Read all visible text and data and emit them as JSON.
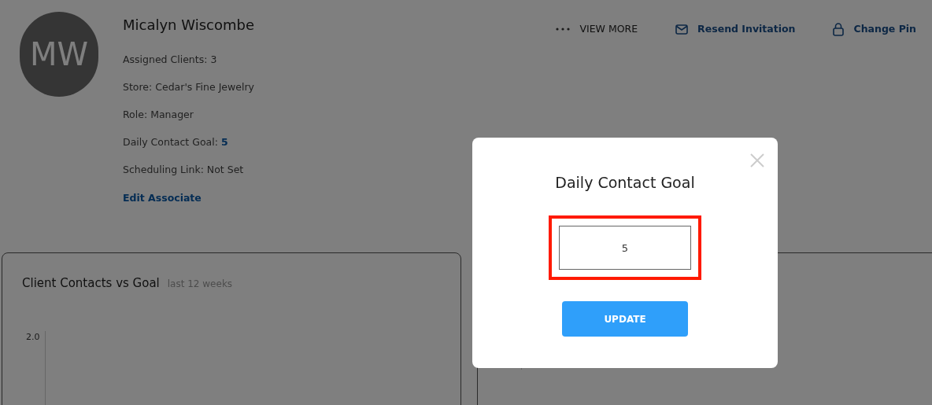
{
  "profile": {
    "initials": "MW",
    "name": "Micalyn Wiscombe",
    "details": [
      {
        "label": "Assigned Clients: ",
        "value": "3",
        "kind": "plain"
      },
      {
        "label": "Store: ",
        "value": "Cedar's Fine Jewelry",
        "kind": "plain"
      },
      {
        "label": "Role: ",
        "value": "Manager",
        "kind": "plain"
      },
      {
        "label": "Daily Contact Goal: ",
        "value": "5",
        "kind": "link"
      },
      {
        "label": "Scheduling Link: ",
        "value": "Not Set",
        "kind": "plain"
      }
    ],
    "edit_link": "Edit Associate"
  },
  "actions": [
    {
      "kind": "more",
      "label": "VIEW MORE"
    },
    {
      "kind": "mail",
      "label": "Resend Invitation"
    },
    {
      "kind": "lock",
      "label": "Change Pin"
    }
  ],
  "cards": [
    {
      "title": "Client Contacts vs Goal",
      "subtitle": "last 12 weeks",
      "axis_label": "2.0"
    }
  ],
  "modal": {
    "title": "Daily Contact Goal",
    "field": {
      "value": "5",
      "highlighted": true
    },
    "button": "UPDATE"
  }
}
